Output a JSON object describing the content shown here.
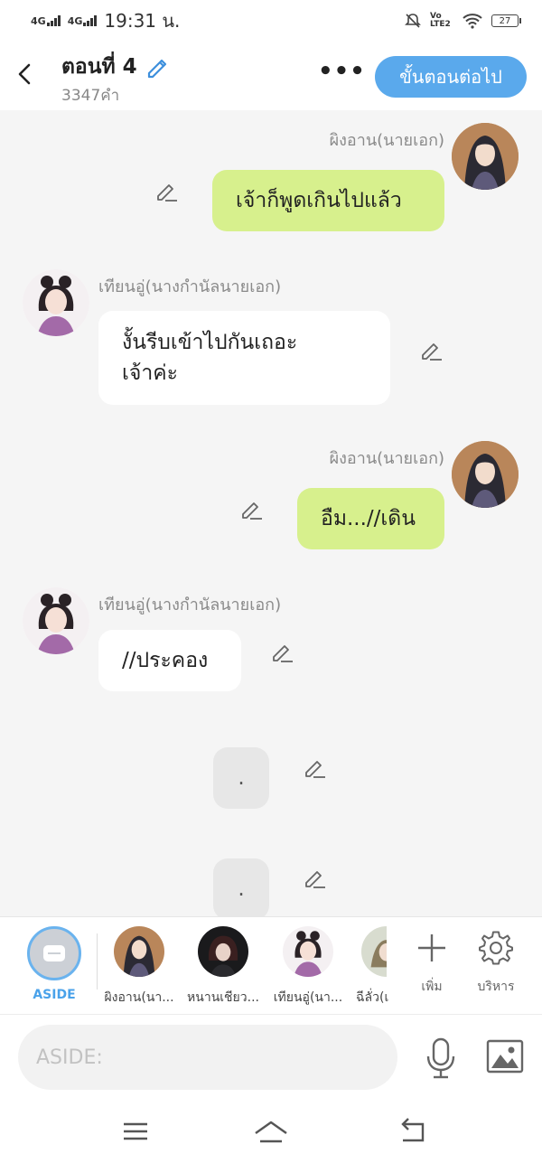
{
  "status_bar": {
    "net1": "4G",
    "net2": "4G",
    "time": "19:31 น.",
    "lte": "Vo LTE2",
    "battery": "27"
  },
  "header": {
    "title": "ตอนที่ 4",
    "word_count": "3347คำ",
    "more": "•••",
    "next_button": "ขั้นตอนต่อไป"
  },
  "messages": [
    {
      "sender": "ผิงอาน(นายเอก)",
      "text": "เจ้าก็พูดเกินไปแล้ว",
      "side": "right"
    },
    {
      "sender": "เทียนอู่(นางกำนัลนายเอก)",
      "text": "งั้นรีบเข้าไปกันเถอะ\nเจ้าค่ะ",
      "side": "left"
    },
    {
      "sender": "ผิงอาน(นายเอก)",
      "text": "อืม...//เดิน",
      "side": "right"
    },
    {
      "sender": "เทียนอู่(นางกำนัลนายเอก)",
      "text": "//ประคอง",
      "side": "left"
    },
    {
      "sender": "",
      "text": ".",
      "side": "aside"
    },
    {
      "sender": "",
      "text": ".",
      "side": "aside"
    }
  ],
  "toolbar": {
    "aside_label": "ASIDE",
    "characters": [
      {
        "label": "ผิงอาน(นา..."
      },
      {
        "label": "หนานเชียว..."
      },
      {
        "label": "เทียนอู่(นา..."
      },
      {
        "label": "ฉีลั่ว(เ"
      }
    ],
    "add_label": "เพิ่ม",
    "manage_label": "บริหาร"
  },
  "input": {
    "placeholder": "ASIDE:"
  },
  "colors": {
    "accent": "#5aa9ec",
    "green_bubble": "#d7f08d",
    "background": "#f5f5f5"
  }
}
